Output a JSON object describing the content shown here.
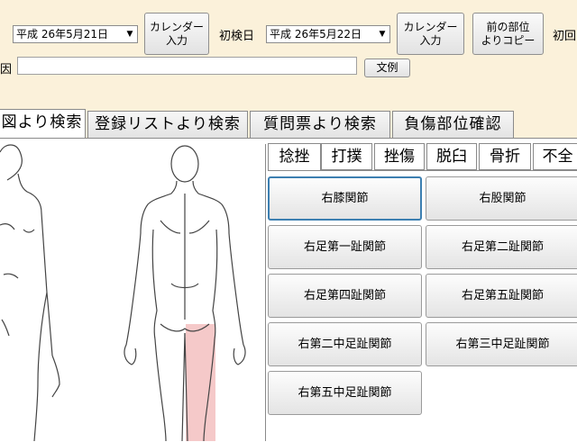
{
  "header": {
    "date1": "平成 26年5月21日",
    "cal_btn1": "カレンダー\n入力",
    "first_visit_label": "初検日",
    "date2": "平成 26年5月22日",
    "cal_btn2": "カレンダー\n入力",
    "copy_prev_btn": "前の部位\nよりコピー",
    "first_visit_right_label": "初回",
    "cause_label": "因",
    "cause_value": "",
    "example_btn": "文例"
  },
  "tabs": [
    {
      "label": "図より検索",
      "active": true
    },
    {
      "label": "登録リストより検索",
      "active": false
    },
    {
      "label": "質問票より検索",
      "active": false
    },
    {
      "label": "負傷部位確認",
      "active": false
    }
  ],
  "injury_tabs": [
    {
      "label": "捻挫",
      "active": true
    },
    {
      "label": "打撲",
      "active": false
    },
    {
      "label": "挫傷",
      "active": false
    },
    {
      "label": "脱臼",
      "active": false
    },
    {
      "label": "骨折",
      "active": false
    },
    {
      "label": "不全",
      "active": false
    }
  ],
  "joints": [
    {
      "label": "右膝関節",
      "focused": true
    },
    {
      "label": "右股関節",
      "focused": false
    },
    {
      "label": "右足第一趾関節",
      "focused": false
    },
    {
      "label": "右足第二趾関節",
      "focused": false
    },
    {
      "label": "右足第四趾関節",
      "focused": false
    },
    {
      "label": "右足第五趾関節",
      "focused": false
    },
    {
      "label": "右第二中足趾関節",
      "focused": false
    },
    {
      "label": "右第三中足趾関節",
      "focused": false
    },
    {
      "label": "右第五中足趾関節",
      "focused": false
    }
  ],
  "colors": {
    "background": "#fbf1da",
    "highlight": "#f5c9c9",
    "focus_border": "#3c7fb1"
  }
}
